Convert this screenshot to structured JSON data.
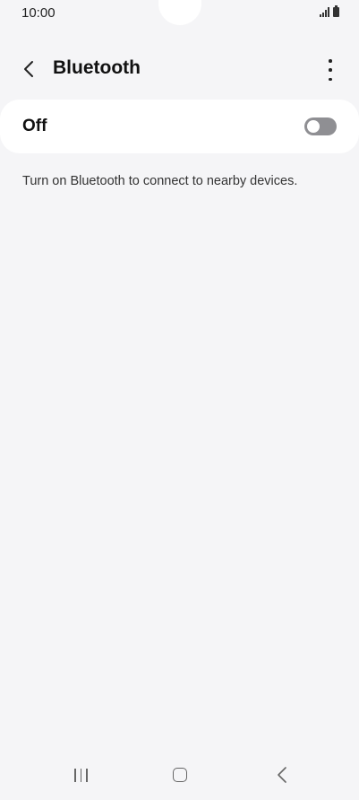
{
  "status_bar": {
    "time": "10:00",
    "signal_icon": "signal-icon",
    "battery_icon": "battery-icon"
  },
  "app_bar": {
    "back_icon": "back-arrow-icon",
    "title": "Bluetooth",
    "more_icon": "more-vertical-icon"
  },
  "bluetooth_toggle": {
    "label": "Off",
    "state": "off"
  },
  "description": "Turn on Bluetooth to connect to nearby devices.",
  "nav_bar": {
    "recents_icon": "recents-icon",
    "home_icon": "home-icon",
    "back_icon": "nav-back-icon"
  },
  "colors": {
    "background": "#f5f5f7",
    "card": "#ffffff",
    "switch_off": "#8f8f93"
  }
}
